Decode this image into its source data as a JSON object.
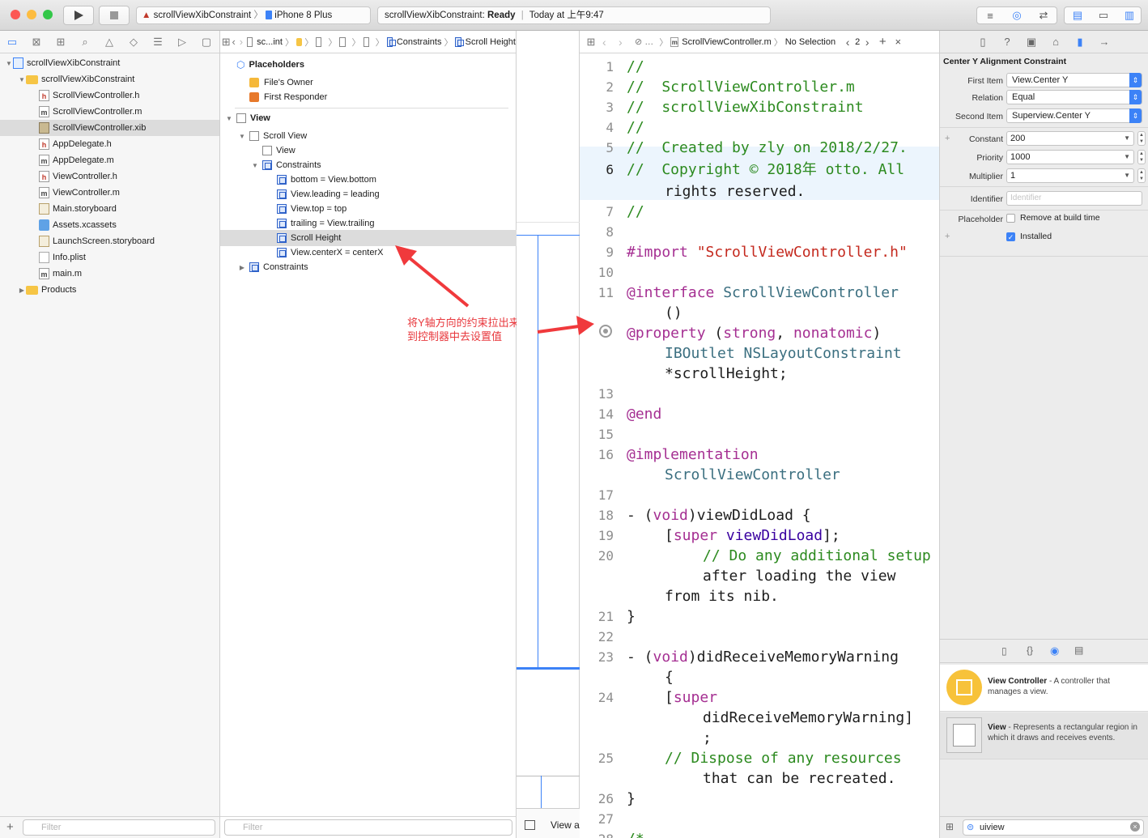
{
  "toolbar": {
    "scheme_project": "scrollViewXibConstraint",
    "scheme_device": "iPhone 8 Plus",
    "activity_project": "scrollViewXibConstraint:",
    "activity_status": "Ready",
    "activity_time": "Today at 上午9:47",
    "colors": {
      "close": "#fc5753",
      "minimize": "#fdbc40",
      "zoom": "#33c748",
      "accent": "#3c82f7"
    }
  },
  "navigator": {
    "items": [
      {
        "label": "scrollViewXibConstraint",
        "kind": "project"
      },
      {
        "label": "scrollViewXibConstraint",
        "kind": "folder"
      },
      {
        "label": "ScrollViewController.h",
        "kind": "h"
      },
      {
        "label": "ScrollViewController.m",
        "kind": "m"
      },
      {
        "label": "ScrollViewController.xib",
        "kind": "xib"
      },
      {
        "label": "AppDelegate.h",
        "kind": "h"
      },
      {
        "label": "AppDelegate.m",
        "kind": "m"
      },
      {
        "label": "ViewController.h",
        "kind": "h"
      },
      {
        "label": "ViewController.m",
        "kind": "m"
      },
      {
        "label": "Main.storyboard",
        "kind": "storyboard"
      },
      {
        "label": "Assets.xcassets",
        "kind": "assets"
      },
      {
        "label": "LaunchScreen.storyboard",
        "kind": "storyboard"
      },
      {
        "label": "Info.plist",
        "kind": "plist"
      },
      {
        "label": "main.m",
        "kind": "m"
      },
      {
        "label": "Products",
        "kind": "folder"
      }
    ],
    "filter_placeholder": "Filter"
  },
  "jumpbar": {
    "crumb1": "sc...int",
    "crumb2": "Constraints",
    "crumb3": "Scroll Height"
  },
  "outline": {
    "placeholders": "Placeholders",
    "files_owner": "File's Owner",
    "first_responder": "First Responder",
    "view": "View",
    "scroll_view": "Scroll View",
    "inner_view": "View",
    "constraints": "Constraints",
    "c1": "bottom = View.bottom",
    "c2": "View.leading = leading",
    "c3": "View.top = top",
    "c4": "trailing = View.trailing",
    "c5": "Scroll Height",
    "c6": "View.centerX = centerX",
    "constraints2": "Constraints",
    "filter_placeholder": "Filter",
    "annotation_line1": "将Y轴方向的约束拉出来,",
    "annotation_line2": "到控制器中去设置值",
    "canvas_label": "View a"
  },
  "editor": {
    "file": "ScrollViewController.m",
    "selection": "No Selection",
    "counter": "2",
    "lines": [
      {
        "n": "1",
        "t": "//"
      },
      {
        "n": "2",
        "t": "//  ScrollViewController.m"
      },
      {
        "n": "3",
        "t": "//  scrollViewXibConstraint"
      },
      {
        "n": "4",
        "t": "//"
      },
      {
        "n": "5",
        "t": "//  Created by zly on 2018/2/27."
      },
      {
        "n": "6",
        "t": "//  Copyright © 2018年 otto. All"
      },
      {
        "n": "",
        "t": "rights reserved."
      },
      {
        "n": "7",
        "t": "//"
      },
      {
        "n": "8",
        "t": ""
      },
      {
        "n": "9",
        "t": "#import \"ScrollViewController.h\""
      },
      {
        "n": "10",
        "t": ""
      },
      {
        "n": "11",
        "t": "@interface ScrollViewController"
      },
      {
        "n": "",
        "t": "()"
      },
      {
        "n": "",
        "t": "@property (strong, nonatomic)"
      },
      {
        "n": "",
        "t": "IBOutlet NSLayoutConstraint"
      },
      {
        "n": "",
        "t": "*scrollHeight;"
      },
      {
        "n": "13",
        "t": ""
      },
      {
        "n": "14",
        "t": "@end"
      },
      {
        "n": "15",
        "t": ""
      },
      {
        "n": "16",
        "t": "@implementation"
      },
      {
        "n": "",
        "t": "ScrollViewController"
      },
      {
        "n": "17",
        "t": ""
      },
      {
        "n": "18",
        "t": "- (void)viewDidLoad {"
      },
      {
        "n": "19",
        "t": "[super viewDidLoad];"
      },
      {
        "n": "20",
        "t": "// Do any additional setup"
      },
      {
        "n": "",
        "t": "after loading the view"
      },
      {
        "n": "",
        "t": "from its nib."
      },
      {
        "n": "21",
        "t": "}"
      },
      {
        "n": "22",
        "t": ""
      },
      {
        "n": "23",
        "t": "- (void)didReceiveMemoryWarning"
      },
      {
        "n": "",
        "t": "{"
      },
      {
        "n": "24",
        "t": "[super"
      },
      {
        "n": "",
        "t": "didReceiveMemoryWarning]"
      },
      {
        "n": "",
        "t": ";"
      },
      {
        "n": "25",
        "t": "// Dispose of any resources"
      },
      {
        "n": "",
        "t": "that can be recreated."
      },
      {
        "n": "26",
        "t": "}"
      },
      {
        "n": "27",
        "t": ""
      },
      {
        "n": "28",
        "t": "/*"
      }
    ]
  },
  "inspector": {
    "title": "Center Y Alignment Constraint",
    "first_item_label": "First Item",
    "first_item": "View.Center Y",
    "relation_label": "Relation",
    "relation": "Equal",
    "second_item_label": "Second Item",
    "second_item": "Superview.Center Y",
    "constant_label": "Constant",
    "constant": "200",
    "priority_label": "Priority",
    "priority": "1000",
    "multiplier_label": "Multiplier",
    "multiplier": "1",
    "identifier_label": "Identifier",
    "identifier_placeholder": "Identifier",
    "placeholder_label": "Placeholder",
    "remove_label": "Remove at build time",
    "installed_label": "Installed",
    "lib1_title": "View Controller",
    "lib1_desc": " - A controller that manages a view.",
    "lib2_title": "View",
    "lib2_desc": " - Represents a rectangular region in which it draws and receives events.",
    "search_value": "uiview"
  }
}
